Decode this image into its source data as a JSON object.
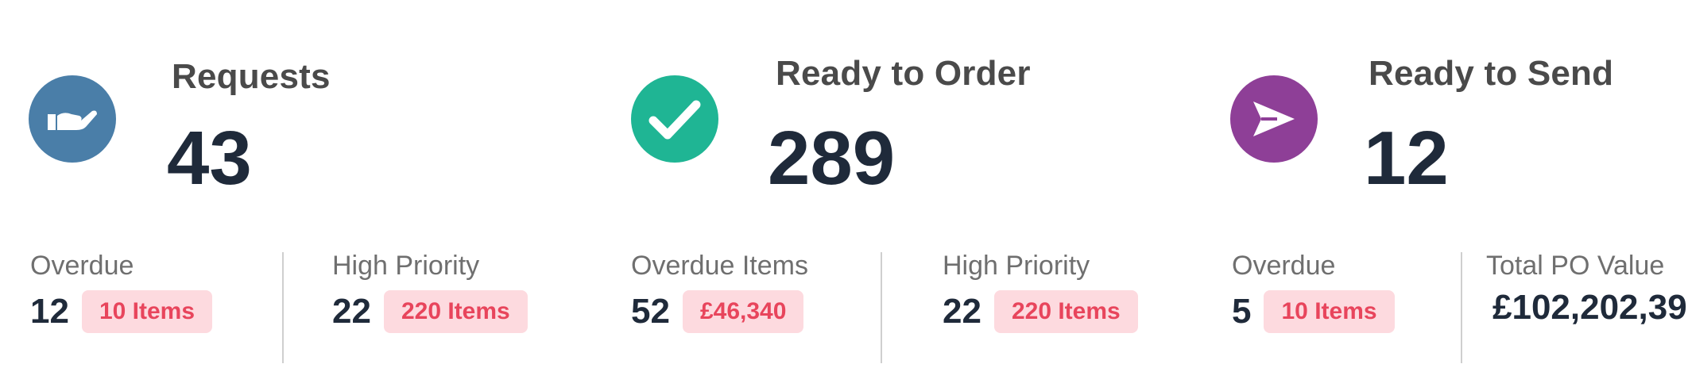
{
  "cards": [
    {
      "title": "Requests",
      "value": "43",
      "icon": "hand-icon",
      "color": "#4a7ea8"
    },
    {
      "title": "Ready to Order",
      "value": "289",
      "icon": "check-icon",
      "color": "#1fb594"
    },
    {
      "title": "Ready to Send",
      "value": "12",
      "icon": "paper-plane-icon",
      "color": "#8e3f97"
    }
  ],
  "metrics": [
    {
      "label": "Overdue",
      "value": "12",
      "badge": "10 Items"
    },
    {
      "label": "High Priority",
      "value": "22",
      "badge": "220 Items"
    },
    {
      "label": "Overdue Items",
      "value": "52",
      "badge": "£46,340"
    },
    {
      "label": "High Priority",
      "value": "22",
      "badge": "220 Items"
    },
    {
      "label": "Overdue",
      "value": "5",
      "badge": "10 Items"
    },
    {
      "label": "Total PO Value",
      "value": "£102,202,39"
    }
  ],
  "colors": {
    "badge_bg": "#fddadf",
    "badge_text": "#e8455c",
    "number": "#1f2a3a"
  }
}
